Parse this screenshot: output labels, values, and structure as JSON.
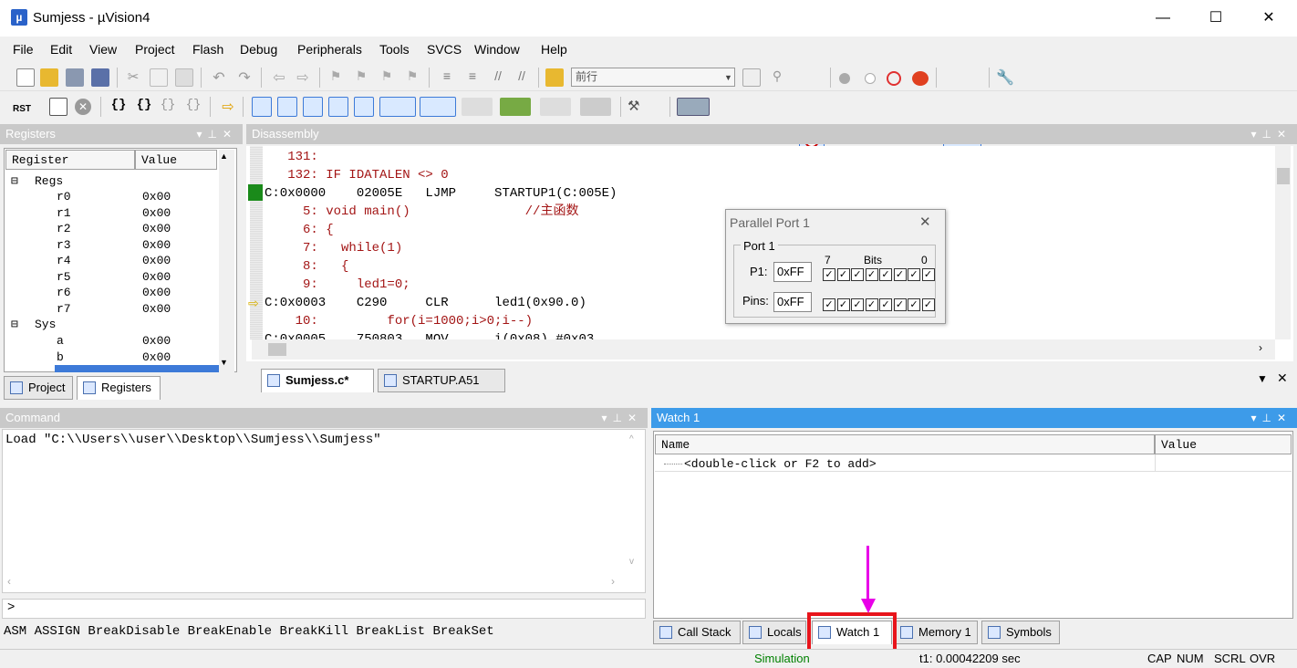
{
  "window": {
    "title": "Sumjess  - µVision4",
    "minimize": "—",
    "maximize": "☐",
    "close": "✕"
  },
  "menu": [
    "File",
    "Edit",
    "View",
    "Project",
    "Flash",
    "Debug",
    "Peripherals",
    "Tools",
    "SVCS",
    "Window",
    "Help"
  ],
  "toolbar": {
    "find_value": "前行",
    "rst_label": "RST"
  },
  "registers": {
    "title": "Registers",
    "col_register": "Register",
    "col_value": "Value",
    "regs_group": "Regs",
    "sys_group": "Sys",
    "regs": [
      [
        "r0",
        "0x00"
      ],
      [
        "r1",
        "0x00"
      ],
      [
        "r2",
        "0x00"
      ],
      [
        "r3",
        "0x00"
      ],
      [
        "r4",
        "0x00"
      ],
      [
        "r5",
        "0x00"
      ],
      [
        "r6",
        "0x00"
      ],
      [
        "r7",
        "0x00"
      ]
    ],
    "sys": [
      [
        "a",
        "0x00"
      ],
      [
        "b",
        "0x00"
      ]
    ],
    "tab_project": "Project",
    "tab_registers": "Registers"
  },
  "disassembly": {
    "title": "Disassembly",
    "lines": [
      {
        "t": "   131:",
        "c": "red"
      },
      {
        "t": "   132: IF IDATALEN <> 0",
        "c": "red"
      },
      {
        "t": "C:0x0000    02005E   LJMP     STARTUP1(C:005E)",
        "c": ""
      },
      {
        "t": "     5: void main()               //主函数",
        "c": "red"
      },
      {
        "t": "     6: {",
        "c": "red"
      },
      {
        "t": "     7:   while(1)",
        "c": "red"
      },
      {
        "t": "     8:   {",
        "c": "red"
      },
      {
        "t": "     9:     led1=0;",
        "c": "red"
      },
      {
        "t": "C:0x0003    C290     CLR      led1(0x90.0)",
        "c": ""
      },
      {
        "t": "    10:         for(i=1000;i>0;i--)",
        "c": "red"
      },
      {
        "t": "C:0x0005    750803   MOV      i(0x08),#0x03",
        "c": ""
      }
    ]
  },
  "editor_tabs": [
    "Sumjess.c*",
    "STARTUP.A51"
  ],
  "parallel_port": {
    "title": "Parallel Port 1",
    "group": "Port 1",
    "bit_hi": "7",
    "bits": "Bits",
    "bit_lo": "0",
    "p1_label": "P1:",
    "p1_value": "0xFF",
    "pins_label": "Pins:",
    "pins_value": "0xFF",
    "check": "✓"
  },
  "command": {
    "title": "Command",
    "output": "Load \"C:\\\\Users\\\\user\\\\Desktop\\\\Sumjess\\\\Sumjess\"",
    "prompt": ">",
    "hints": "ASM ASSIGN BreakDisable BreakEnable BreakKill BreakList BreakSet"
  },
  "watch": {
    "title": "Watch 1",
    "col_name": "Name",
    "col_value": "Value",
    "placeholder_row": "<double-click or F2 to add>",
    "tabs": [
      "Call Stack",
      "Locals",
      "Watch 1",
      "Memory 1",
      "Symbols"
    ]
  },
  "statusbar": {
    "mode": "Simulation",
    "time": "t1: 0.00042209 sec",
    "cap": "CAP",
    "num": "NUM",
    "scrl": "SCRL",
    "ovr": "OVR"
  },
  "colors": {
    "accent": "#3d9be9",
    "highlight_box": "#e8141b",
    "arrow": "#e800e8",
    "sim_green": "#008000"
  }
}
